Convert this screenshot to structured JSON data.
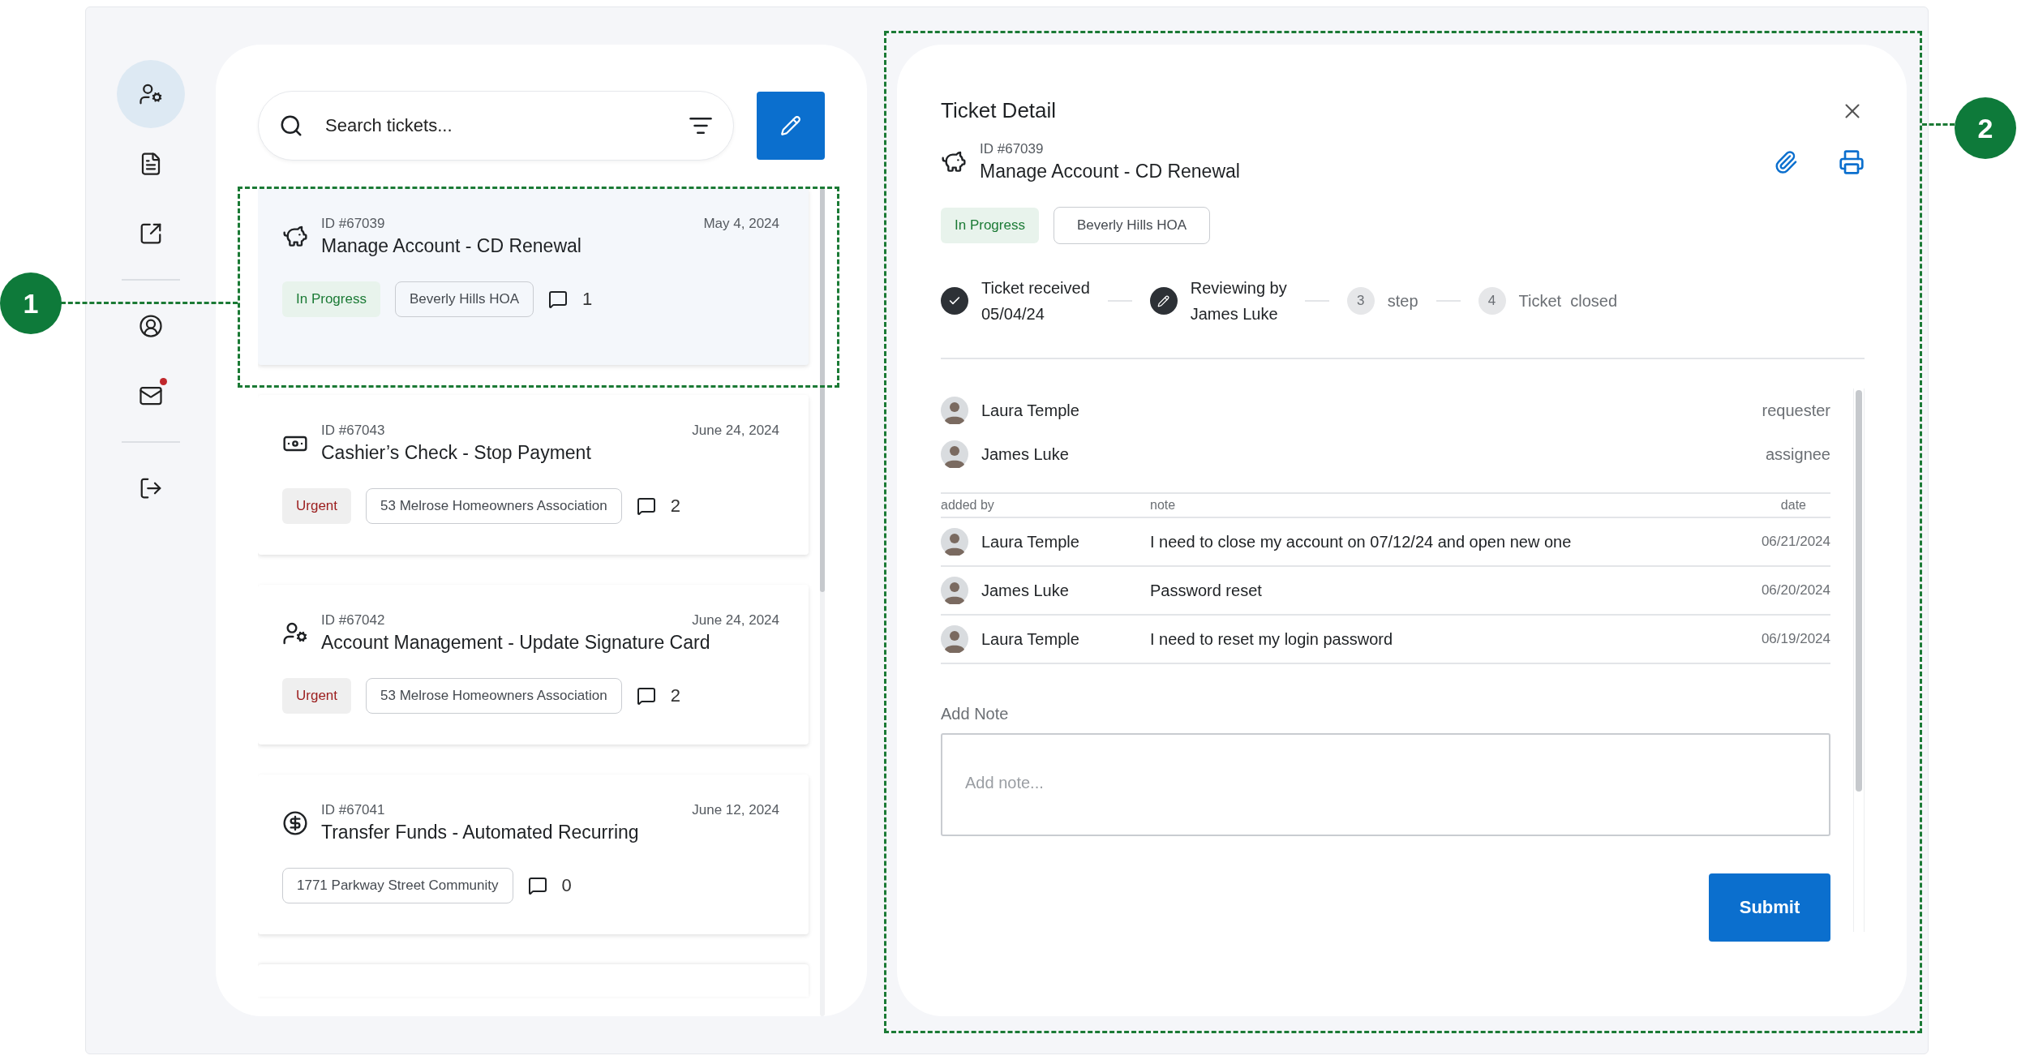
{
  "sidebar": {
    "items": [
      {
        "kind": "user-gear",
        "selected": true,
        "badge": false
      },
      {
        "kind": "document",
        "selected": false,
        "badge": false
      },
      {
        "kind": "external",
        "selected": false,
        "badge": false
      },
      {
        "kind": "divider"
      },
      {
        "kind": "profile",
        "selected": false,
        "badge": false
      },
      {
        "kind": "mail",
        "selected": false,
        "badge": true
      },
      {
        "kind": "divider"
      },
      {
        "kind": "logout",
        "selected": false,
        "badge": false
      }
    ]
  },
  "search": {
    "placeholder": "Search tickets..."
  },
  "tickets": [
    {
      "kind": "piggy",
      "id": "ID #67039",
      "title": "Manage Account - CD Renewal",
      "date": "May 4, 2024",
      "status": {
        "label": "In Progress",
        "kind": "success"
      },
      "group": "Beverly Hills HOA",
      "comments": "1",
      "selected": true
    },
    {
      "kind": "cash",
      "id": "ID #67043",
      "title": "Cashier’s Check - Stop Payment",
      "date": "June 24, 2024",
      "status": {
        "label": "Urgent",
        "kind": "danger"
      },
      "group": "53 Melrose Homeowners Association",
      "comments": "2",
      "selected": false
    },
    {
      "kind": "user-gear",
      "id": "ID #67042",
      "title": "Account Management - Update Signature Card",
      "date": "June 24, 2024",
      "status": {
        "label": "Urgent",
        "kind": "danger"
      },
      "group": "53 Melrose Homeowners Association",
      "comments": "2",
      "selected": false
    },
    {
      "kind": "dollar-cycle",
      "id": "ID #67041",
      "title": "Transfer Funds - Automated Recurring",
      "date": "June 12, 2024",
      "group": "1771 Parkway Street Community",
      "comments": "0",
      "selected": false
    }
  ],
  "detail": {
    "title": "Ticket Detail",
    "kind": "piggy",
    "id": "ID #67039",
    "subject": "Manage Account - CD Renewal",
    "status": {
      "label": "In Progress",
      "kind": "success"
    },
    "group": "Beverly Hills HOA",
    "steps": [
      {
        "kind": "done",
        "label": "Ticket received",
        "sub": "05/04/24"
      },
      {
        "kind": "current",
        "label": "Reviewing by",
        "sub": "James Luke"
      },
      {
        "kind": "pending",
        "number": "3",
        "label": "step"
      },
      {
        "kind": "pending",
        "number": "4",
        "label": "Ticket  closed"
      }
    ],
    "people": [
      {
        "name": "Laura Temple",
        "role": "requester"
      },
      {
        "name": "James Luke",
        "role": "assignee"
      }
    ],
    "notes": {
      "columns": [
        "added by",
        "note",
        "date"
      ],
      "rows": [
        {
          "author": "Laura Temple",
          "note": "I need to close my account on 07/12/24 and open new one",
          "date": "06/21/2024"
        },
        {
          "author": "James Luke",
          "note": "Password reset",
          "date": "06/20/2024"
        },
        {
          "author": "Laura Temple",
          "note": "I need to reset my login password",
          "date": "06/19/2024"
        }
      ]
    },
    "add_note": {
      "label": "Add Note",
      "placeholder": "Add note..."
    },
    "submit": "Submit"
  },
  "callouts": [
    "1",
    "2"
  ]
}
